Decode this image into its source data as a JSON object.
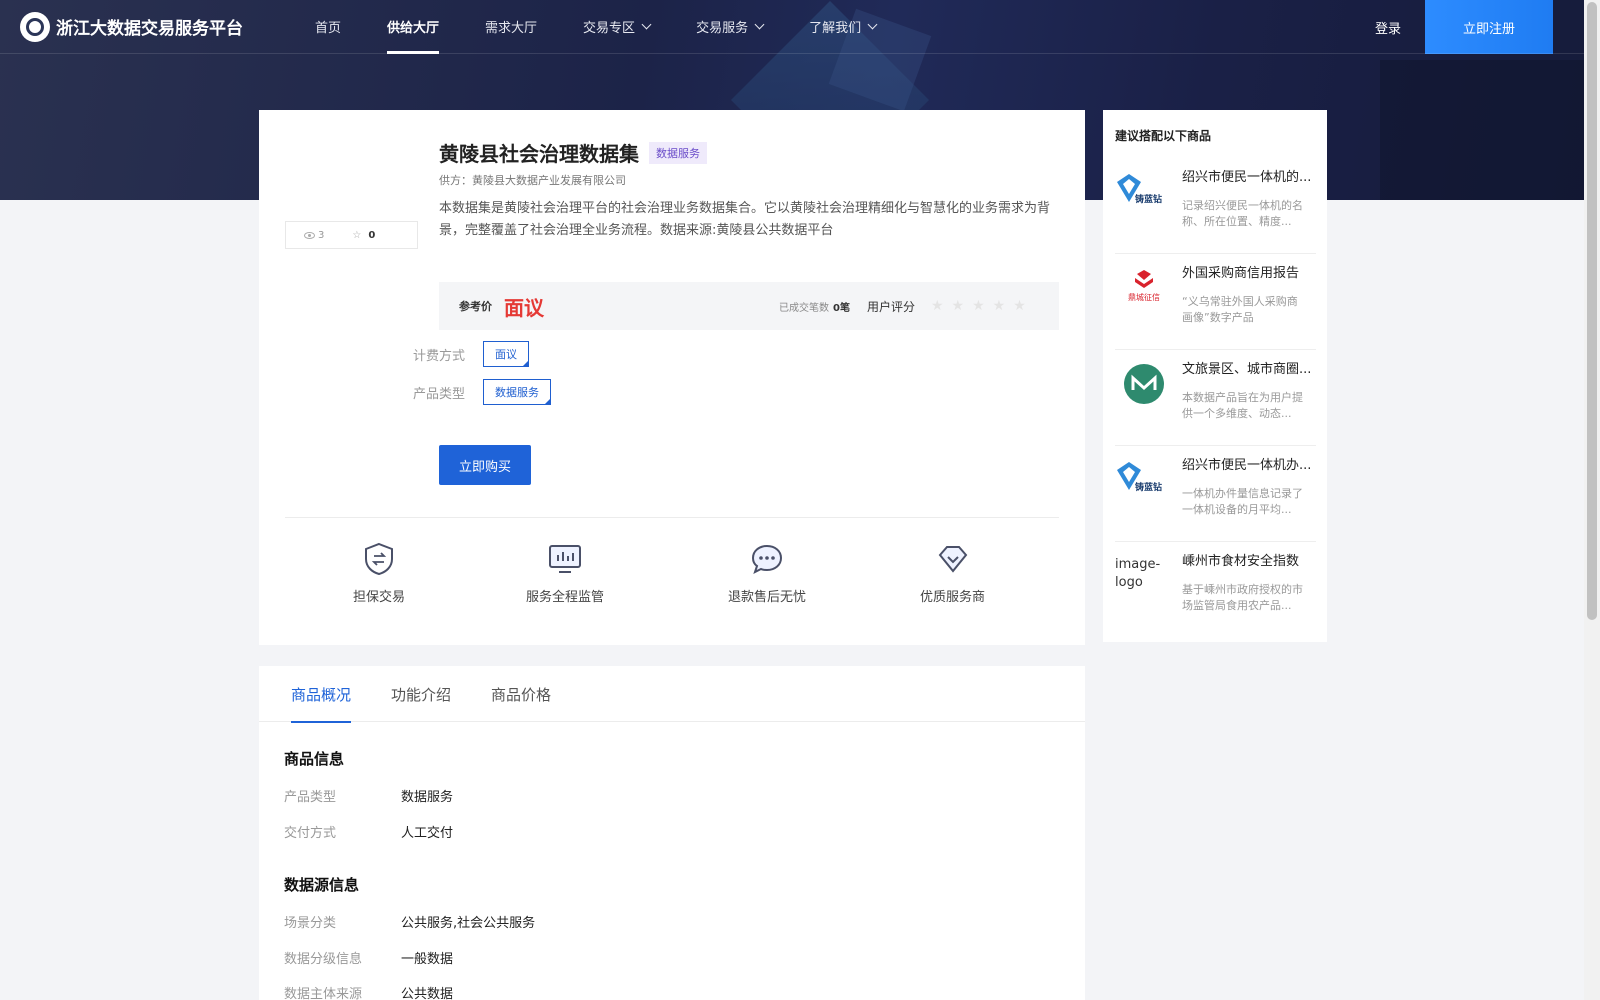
{
  "nav": {
    "brand": "浙江大数据交易服务平台",
    "items": [
      {
        "label": "首页",
        "dropdown": false,
        "active": false
      },
      {
        "label": "供给大厅",
        "dropdown": false,
        "active": true
      },
      {
        "label": "需求大厅",
        "dropdown": false,
        "active": false
      },
      {
        "label": "交易专区",
        "dropdown": true,
        "active": false
      },
      {
        "label": "交易服务",
        "dropdown": true,
        "active": false
      },
      {
        "label": "了解我们",
        "dropdown": true,
        "active": false
      }
    ],
    "login": "登录",
    "register": "立即注册"
  },
  "product": {
    "title": "黄陵县社会治理数据集",
    "tag": "数据服务",
    "supplier": "供方：黄陵县大数据产业发展有限公司",
    "description": "本数据集是黄陵社会治理平台的社会治理业务数据集合。它以黄陵社会治理精细化与智慧化的业务需求为背景，完整覆盖了社会治理全业务流程。数据来源:黄陵县公共数据平台",
    "views": "3",
    "favorites": "0",
    "price_label": "参考价",
    "price_value": "面议",
    "deals_label": "已成交笔数",
    "deals_value": "0笔",
    "rating_label": "用户评分",
    "rating_stars": "★★★★★",
    "billing_label": "计费方式",
    "billing_value": "面议",
    "type_label": "产品类型",
    "type_value": "数据服务",
    "buy_label": "立即购买"
  },
  "features": [
    {
      "label": "担保交易",
      "icon": "shield-exchange-icon"
    },
    {
      "label": "服务全程监管",
      "icon": "monitor-chart-icon"
    },
    {
      "label": "退款售后无忧",
      "icon": "chat-bubble-icon"
    },
    {
      "label": "优质服务商",
      "icon": "diamond-icon"
    }
  ],
  "recommend": {
    "title": "建议搭配以下商品",
    "items": [
      {
        "name": "绍兴市便民一体机的...",
        "desc": "记录绍兴便民一体机的名称、所在位置、精度...",
        "logo": "铸蓝钻"
      },
      {
        "name": "外国采购商信用报告",
        "desc": "“义乌常驻外国人采购商画像”数字产品",
        "logo": "鼎城征信"
      },
      {
        "name": "文旅景区、城市商圈...",
        "desc": "本数据产品旨在为用户提供一个多维度、动态...",
        "logo": ""
      },
      {
        "name": "绍兴市便民一体机办...",
        "desc": "一体机办件量信息记录了一体机设备的月平均...",
        "logo": "铸蓝钻"
      },
      {
        "name": "嵊州市食材安全指数",
        "desc": "基于嵊州市政府授权的市场监管局食用农产品...",
        "logo": "image-logo"
      }
    ]
  },
  "detail": {
    "tabs": [
      {
        "label": "商品概况",
        "active": true
      },
      {
        "label": "功能介绍",
        "active": false
      },
      {
        "label": "商品价格",
        "active": false
      }
    ],
    "section1_title": "商品信息",
    "section1": [
      {
        "k": "产品类型",
        "v": "数据服务"
      },
      {
        "k": "交付方式",
        "v": "人工交付"
      }
    ],
    "section2_title": "数据源信息",
    "section2": [
      {
        "k": "场景分类",
        "v": "公共服务,社会公共服务"
      },
      {
        "k": "数据分级信息",
        "v": "一般数据"
      },
      {
        "k": "数据主体来源",
        "v": "公共数据"
      }
    ]
  },
  "colors": {
    "primary": "#1f63d8",
    "price": "#e53935",
    "nav_bg": "#2a3150"
  }
}
